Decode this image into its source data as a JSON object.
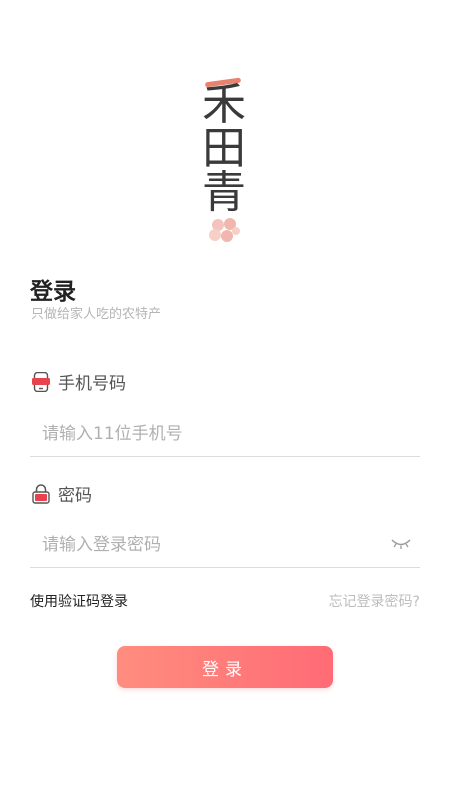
{
  "logo": {
    "chars": [
      "禾",
      "田",
      "青"
    ],
    "accent_color": "#e8826f",
    "flower_color": "#f1b6ad"
  },
  "header": {
    "title": "登录",
    "subtitle": "只做给家人吃的农特产"
  },
  "phone": {
    "label": "手机号码",
    "icon": "phone-icon",
    "placeholder": "请输入11位手机号",
    "value": ""
  },
  "password": {
    "label": "密码",
    "icon": "lock-icon",
    "placeholder": "请输入登录密码",
    "value": "",
    "toggle_icon": "eye-closed-icon"
  },
  "links": {
    "code_login": "使用验证码登录",
    "forgot_password": "忘记登录密码?"
  },
  "login_button": {
    "label": "登录",
    "gradient_start": "#ff8d7e",
    "gradient_end": "#ff6b76"
  }
}
